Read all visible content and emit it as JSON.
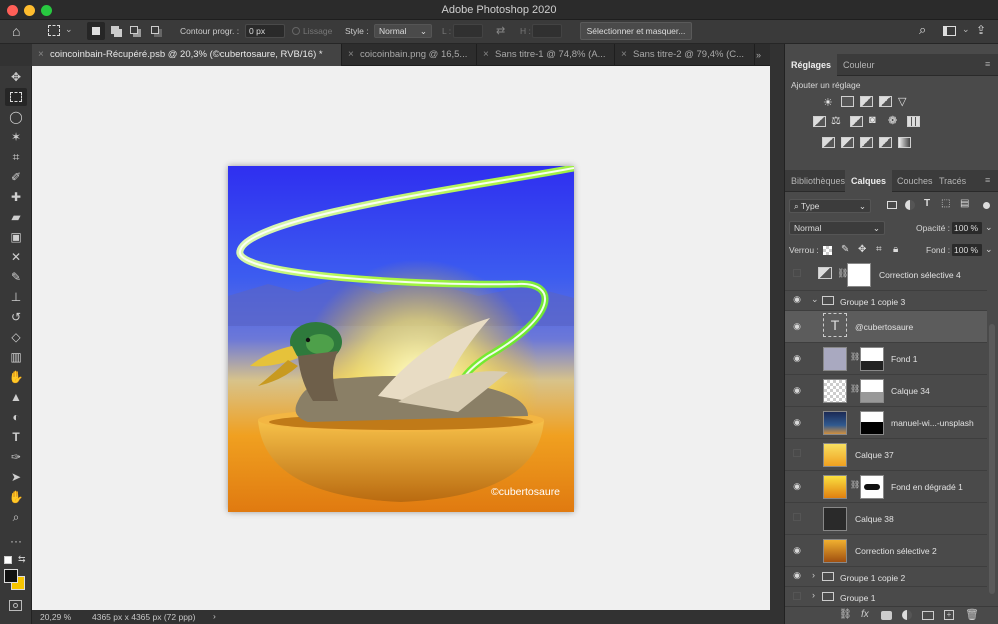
{
  "window": {
    "title": "Adobe Photoshop 2020"
  },
  "options": {
    "contour_label": "Contour progr. :",
    "contour_value": "0 px",
    "lissage": "Lissage",
    "style_label": "Style :",
    "style_value": "Normal",
    "l_label": "L :",
    "h_label": "H :",
    "select_mask": "Sélectionner et masquer..."
  },
  "tabs": [
    {
      "label": "coincoinbain-Récupéré.psb @ 20,3% (©cubertosaure, RVB/16) *"
    },
    {
      "label": "coicoinbain.png @ 16,5..."
    },
    {
      "label": "Sans titre-1 @ 74,8% (A..."
    },
    {
      "label": "Sans titre-2 @ 79,4% (C..."
    }
  ],
  "canvas": {
    "watermark": "©cubertosaure"
  },
  "status": {
    "zoom": "20,29 %",
    "size": "4365 px x 4365 px (72 ppp)",
    "arrow": "›"
  },
  "adjustments": {
    "tabs": [
      "Réglages",
      "Couleur"
    ],
    "add_label": "Ajouter un réglage"
  },
  "layers_panel": {
    "tabs": [
      "Bibliothèques",
      "Calques",
      "Couches",
      "Tracés"
    ],
    "filter": "Type",
    "blend": "Normal",
    "opacity_label": "Opacité :",
    "opacity": "100 %",
    "lock_label": "Verrou :",
    "fill_label": "Fond :",
    "fill": "100 %",
    "layers": [
      {
        "name": "Correction sélective 4"
      },
      {
        "name": "Groupe 1 copie 3"
      },
      {
        "name": "@cubertosaure"
      },
      {
        "name": "Fond 1"
      },
      {
        "name": "Calque 34"
      },
      {
        "name": "manuel-wi...-unsplash"
      },
      {
        "name": "Calque 37"
      },
      {
        "name": "Fond en dégradé 1"
      },
      {
        "name": "Calque 38"
      },
      {
        "name": "Correction sélective 2"
      },
      {
        "name": "Groupe 1 copie 2"
      },
      {
        "name": "Groupe 1"
      }
    ]
  },
  "colors": {
    "accent": "#3b79f0",
    "fg_swatch": "#111111",
    "bg_swatch": "#f6c400"
  }
}
